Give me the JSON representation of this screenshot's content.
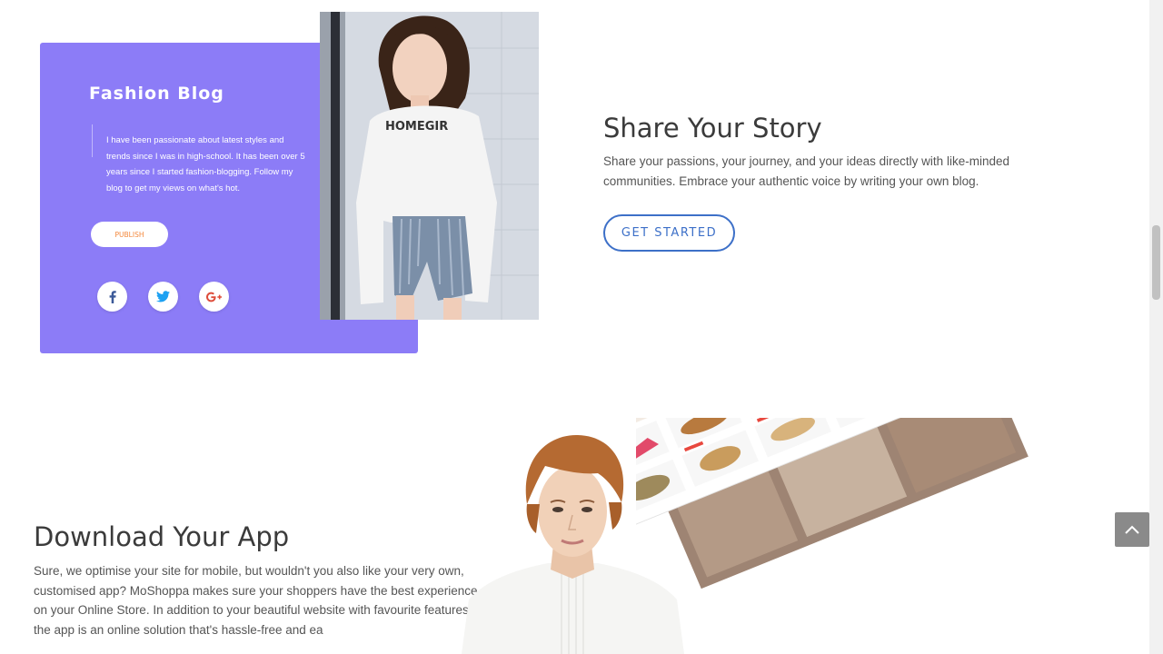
{
  "blog": {
    "title": "Fashion Blog",
    "description": "I have been passionate about latest styles and trends since I was in high-school. It has been over 5 years since I started fashion-blogging. Follow my blog to get my views on what's hot.",
    "publish_label": "PUBLISH",
    "photo_text": "HOMEGIR",
    "social": [
      "facebook-icon",
      "twitter-icon",
      "google-plus-icon"
    ]
  },
  "story": {
    "heading": "Share Your Story",
    "text": "Share your passions, your journey, and your ideas directly with like-minded communities. Embrace your authentic voice by writing your own blog.",
    "cta_label": "GET STARTED"
  },
  "app": {
    "heading": "Download Your App",
    "text": "Sure, we optimise your site for mobile, but wouldn't you also like your very own, customised app? MoShoppa makes sure your shoppers have the best experience on your Online Store. In addition to your beautiful website with favourite features, the app is an online solution that's hassle-free and ea"
  },
  "colors": {
    "card": "#8c7cf7",
    "accent_blue": "#3d70c8",
    "publish_orange": "#f4873a"
  }
}
